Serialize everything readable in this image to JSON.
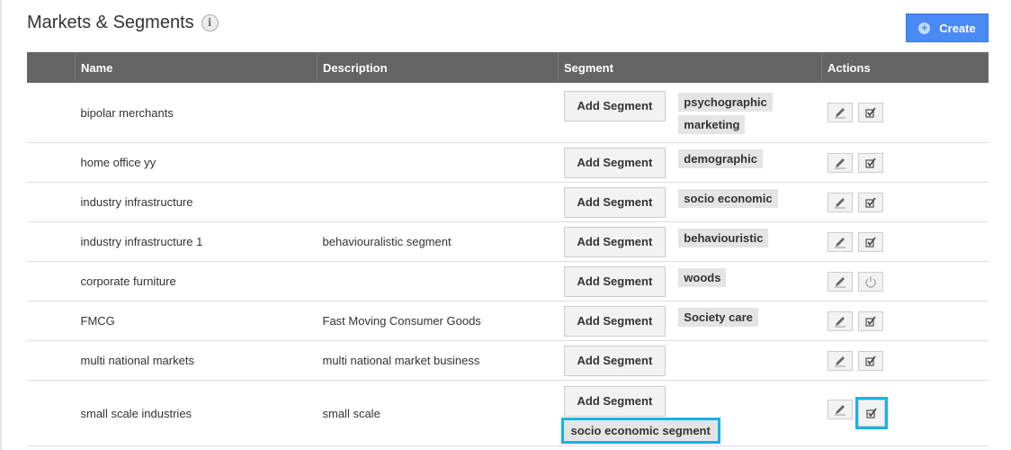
{
  "page": {
    "title": "Markets & Segments",
    "info_icon": "i",
    "create_label": "Create",
    "create_icon": "+"
  },
  "table": {
    "headers": [
      "",
      "Name",
      "Description",
      "Segment",
      "Actions"
    ],
    "add_segment_label": "Add Segment",
    "rows": [
      {
        "name": "bipolar merchants",
        "description": "",
        "segments": [
          "psychographic",
          "marketing"
        ],
        "second_action": "check"
      },
      {
        "name": "home office yy",
        "description": "",
        "segments": [
          "demographic"
        ],
        "second_action": "check"
      },
      {
        "name": "industry infrastructure",
        "description": "",
        "segments": [
          "socio economic"
        ],
        "second_action": "check"
      },
      {
        "name": "industry infrastructure 1",
        "description": "behaviouralistic segment",
        "segments": [
          "behaviouristic"
        ],
        "second_action": "check"
      },
      {
        "name": "corporate furniture",
        "description": "",
        "segments": [
          "woods"
        ],
        "second_action": "power"
      },
      {
        "name": "FMCG",
        "description": "Fast Moving Consumer Goods",
        "segments": [
          "Society care"
        ],
        "second_action": "check"
      },
      {
        "name": "multi national markets",
        "description": "multi national market business",
        "segments": [],
        "second_action": "check"
      },
      {
        "name": "small scale industries",
        "description": "small scale",
        "segments": [
          "socio economic segment"
        ],
        "second_action": "check",
        "highlighted": true
      }
    ]
  },
  "colors": {
    "header_bg": "#646464",
    "create_bg": "#4a8af4",
    "highlight": "#14b4e6"
  }
}
